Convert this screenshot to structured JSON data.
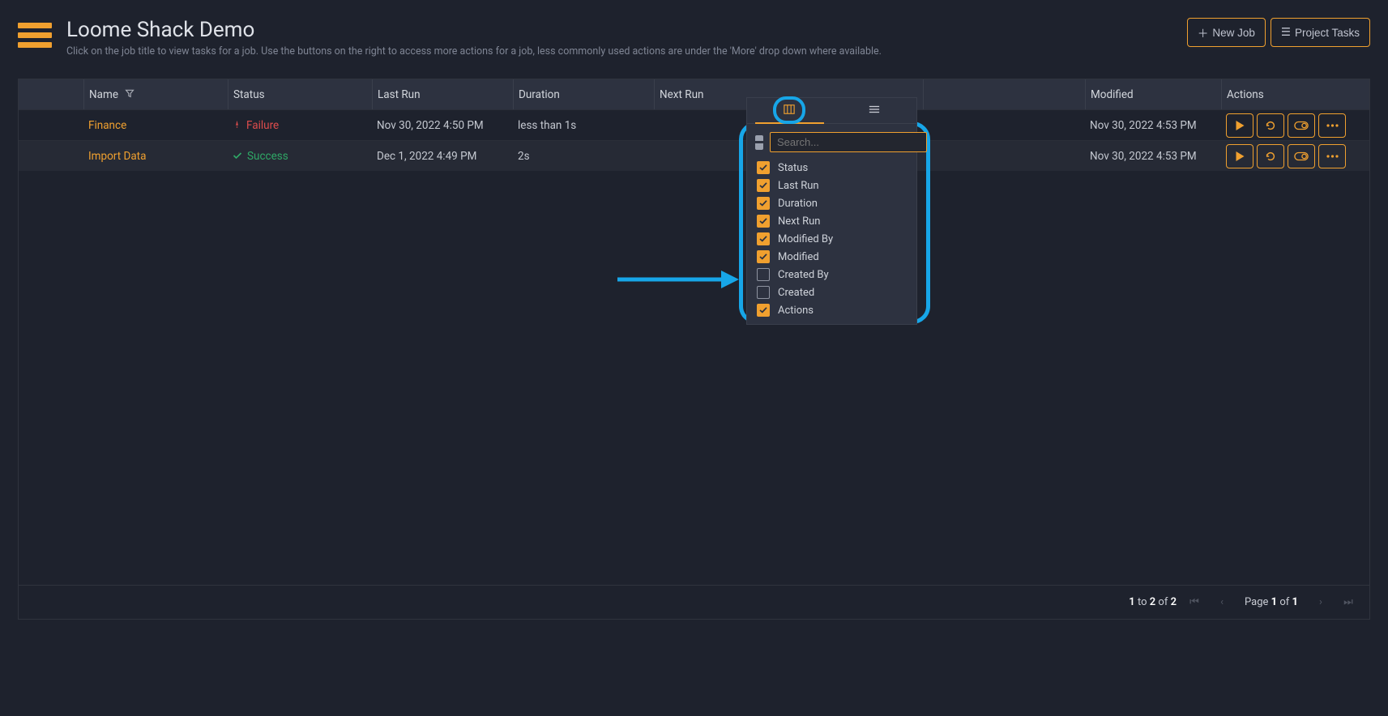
{
  "pageTitle": "Loome Shack Demo",
  "pageSubtitle": "Click on the job title to view tasks for a job. Use the buttons on the right to access more actions for a job, less commonly used actions are under the 'More' drop down where available.",
  "buttons": {
    "newJob": "New Job",
    "projectTasks": "Project Tasks"
  },
  "columns": {
    "name": "Name",
    "status": "Status",
    "lastRun": "Last Run",
    "duration": "Duration",
    "nextRun": "Next Run",
    "modified": "Modified",
    "actions": "Actions"
  },
  "rows": [
    {
      "name": "Finance",
      "statusText": "Failure",
      "statusKind": "failure",
      "lastRun": "Nov 30, 2022 4:50 PM",
      "duration": "less than 1s",
      "nextRun": "",
      "modified": "Nov 30, 2022 4:53 PM"
    },
    {
      "name": "Import Data",
      "statusText": "Success",
      "statusKind": "success",
      "lastRun": "Dec 1, 2022 4:49 PM",
      "duration": "2s",
      "nextRun": "",
      "modified": "Nov 30, 2022 4:53 PM"
    }
  ],
  "columnChooser": {
    "searchPlaceholder": "Search...",
    "items": [
      {
        "label": "Status",
        "checked": true
      },
      {
        "label": "Last Run",
        "checked": true
      },
      {
        "label": "Duration",
        "checked": true
      },
      {
        "label": "Next Run",
        "checked": true
      },
      {
        "label": "Modified By",
        "checked": true
      },
      {
        "label": "Modified",
        "checked": true
      },
      {
        "label": "Created By",
        "checked": false
      },
      {
        "label": "Created",
        "checked": false
      },
      {
        "label": "Actions",
        "checked": true
      }
    ]
  },
  "pager": {
    "summaryPrefix": "1",
    "summaryTo": "to",
    "summaryEnd": "2",
    "summaryOf": "of",
    "summaryTotal": "2",
    "pageWord": "Page",
    "pageCurrent": "1",
    "pageOf": "of",
    "pageTotal": "1"
  }
}
